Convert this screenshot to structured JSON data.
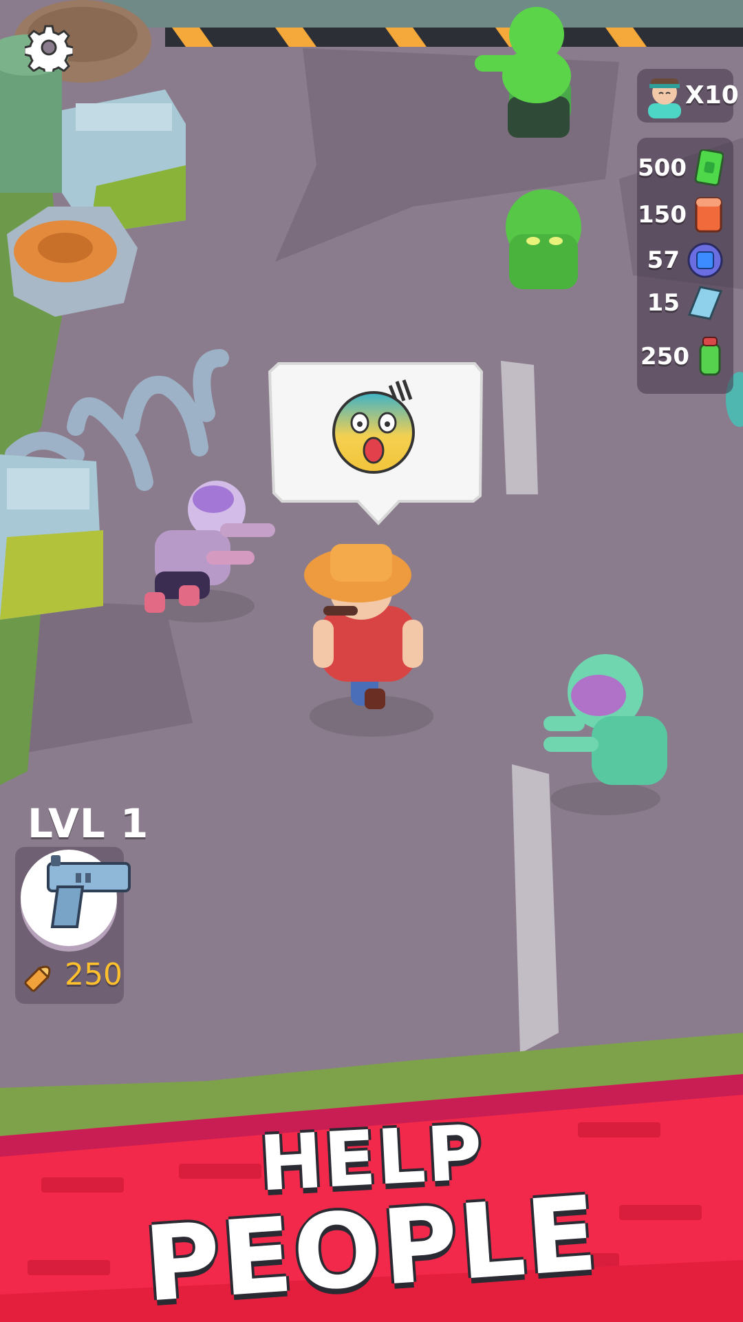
{
  "hud": {
    "settings_icon": "gear-icon",
    "people_count": "X10",
    "resources": [
      {
        "value": "500",
        "icon": "cash-icon",
        "color": "#4fd84a"
      },
      {
        "value": "150",
        "icon": "brick-icon",
        "color": "#f06a3c"
      },
      {
        "value": "57",
        "icon": "chip-icon",
        "color": "#3d8cff"
      },
      {
        "value": "15",
        "icon": "glass-icon",
        "color": "#8fd0ea"
      },
      {
        "value": "250",
        "icon": "potion-icon",
        "color": "#56d24e"
      }
    ]
  },
  "weapon": {
    "level": "LVL 1",
    "icon": "pistol-icon",
    "ammo_icon": "bullet-icon",
    "ammo": "250"
  },
  "speech": {
    "emoji": "scared-face-icon"
  },
  "banner": {
    "line1": "HELP",
    "line2": "PEOPLE",
    "color": "#f2294a"
  }
}
